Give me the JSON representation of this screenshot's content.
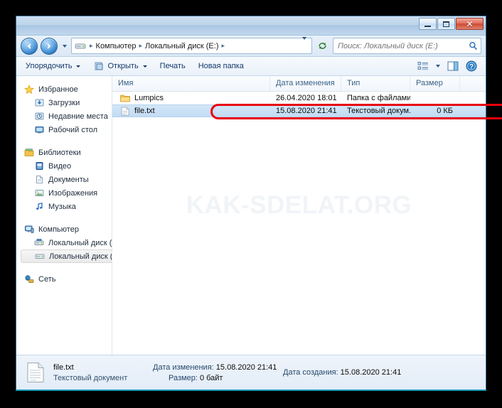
{
  "window": {
    "titlebar_buttons": {
      "minimize": "Свернуть",
      "maximize": "Развернуть",
      "close": "Закрыть"
    }
  },
  "address_bar": {
    "back": "Назад",
    "forward": "Вперед",
    "history_dropdown": "Последние страницы",
    "crumbs": [
      "Компьютер",
      "Локальный диск (E:)"
    ],
    "separator": "▸",
    "refresh": "Обновить",
    "search_placeholder": "Поиск: Локальный диск (E:)",
    "search_value": "",
    "search_icon": "search-icon"
  },
  "toolbar": {
    "organize": "Упорядочить",
    "open": "Открыть",
    "print": "Печать",
    "new_folder": "Новая папка",
    "view_icon": "list-view-icon",
    "preview_icon": "preview-pane-icon",
    "help_icon": "help-icon"
  },
  "sidebar": {
    "groups": [
      {
        "header": {
          "label": "Избранное",
          "icon": "star-icon"
        },
        "items": [
          {
            "label": "Загрузки",
            "icon": "downloads-icon"
          },
          {
            "label": "Недавние места",
            "icon": "recent-places-icon"
          },
          {
            "label": "Рабочий стол",
            "icon": "desktop-icon"
          }
        ]
      },
      {
        "header": {
          "label": "Библиотеки",
          "icon": "libraries-icon"
        },
        "items": [
          {
            "label": "Видео",
            "icon": "video-icon"
          },
          {
            "label": "Документы",
            "icon": "documents-icon"
          },
          {
            "label": "Изображения",
            "icon": "pictures-icon"
          },
          {
            "label": "Музыка",
            "icon": "music-icon"
          }
        ]
      },
      {
        "header": {
          "label": "Компьютер",
          "icon": "computer-icon"
        },
        "items": [
          {
            "label": "Локальный диск (C",
            "icon": "system-drive-icon"
          },
          {
            "label": "Локальный диск (E:",
            "icon": "drive-icon",
            "selected": true
          }
        ]
      },
      {
        "header": {
          "label": "Сеть",
          "icon": "network-icon"
        },
        "items": []
      }
    ]
  },
  "file_list": {
    "columns": [
      "Имя",
      "Дата изменения",
      "Тип",
      "Размер"
    ],
    "rows": [
      {
        "name": "Lumpics",
        "date": "26.04.2020 18:01",
        "type": "Папка с файлами",
        "size": "",
        "icon": "folder-icon",
        "selected": false
      },
      {
        "name": "file.txt",
        "date": "15.08.2020 21:41",
        "type": "Текстовый докум...",
        "size": "0 КБ",
        "icon": "text-file-icon",
        "selected": true
      }
    ],
    "watermark": "KAK-SDELAT.ORG"
  },
  "details_pane": {
    "file_name": "file.txt",
    "file_type": "Текстовый документ",
    "modified_label": "Дата изменения:",
    "modified_value": "15.08.2020 21:41",
    "size_label": "Размер:",
    "size_value": "0 байт",
    "created_label": "Дата создания:",
    "created_value": "15.08.2020 21:41",
    "icon": "text-file-large-icon"
  },
  "annotation": {
    "highlight_color": "#e8000d",
    "target": "file.txt row"
  }
}
